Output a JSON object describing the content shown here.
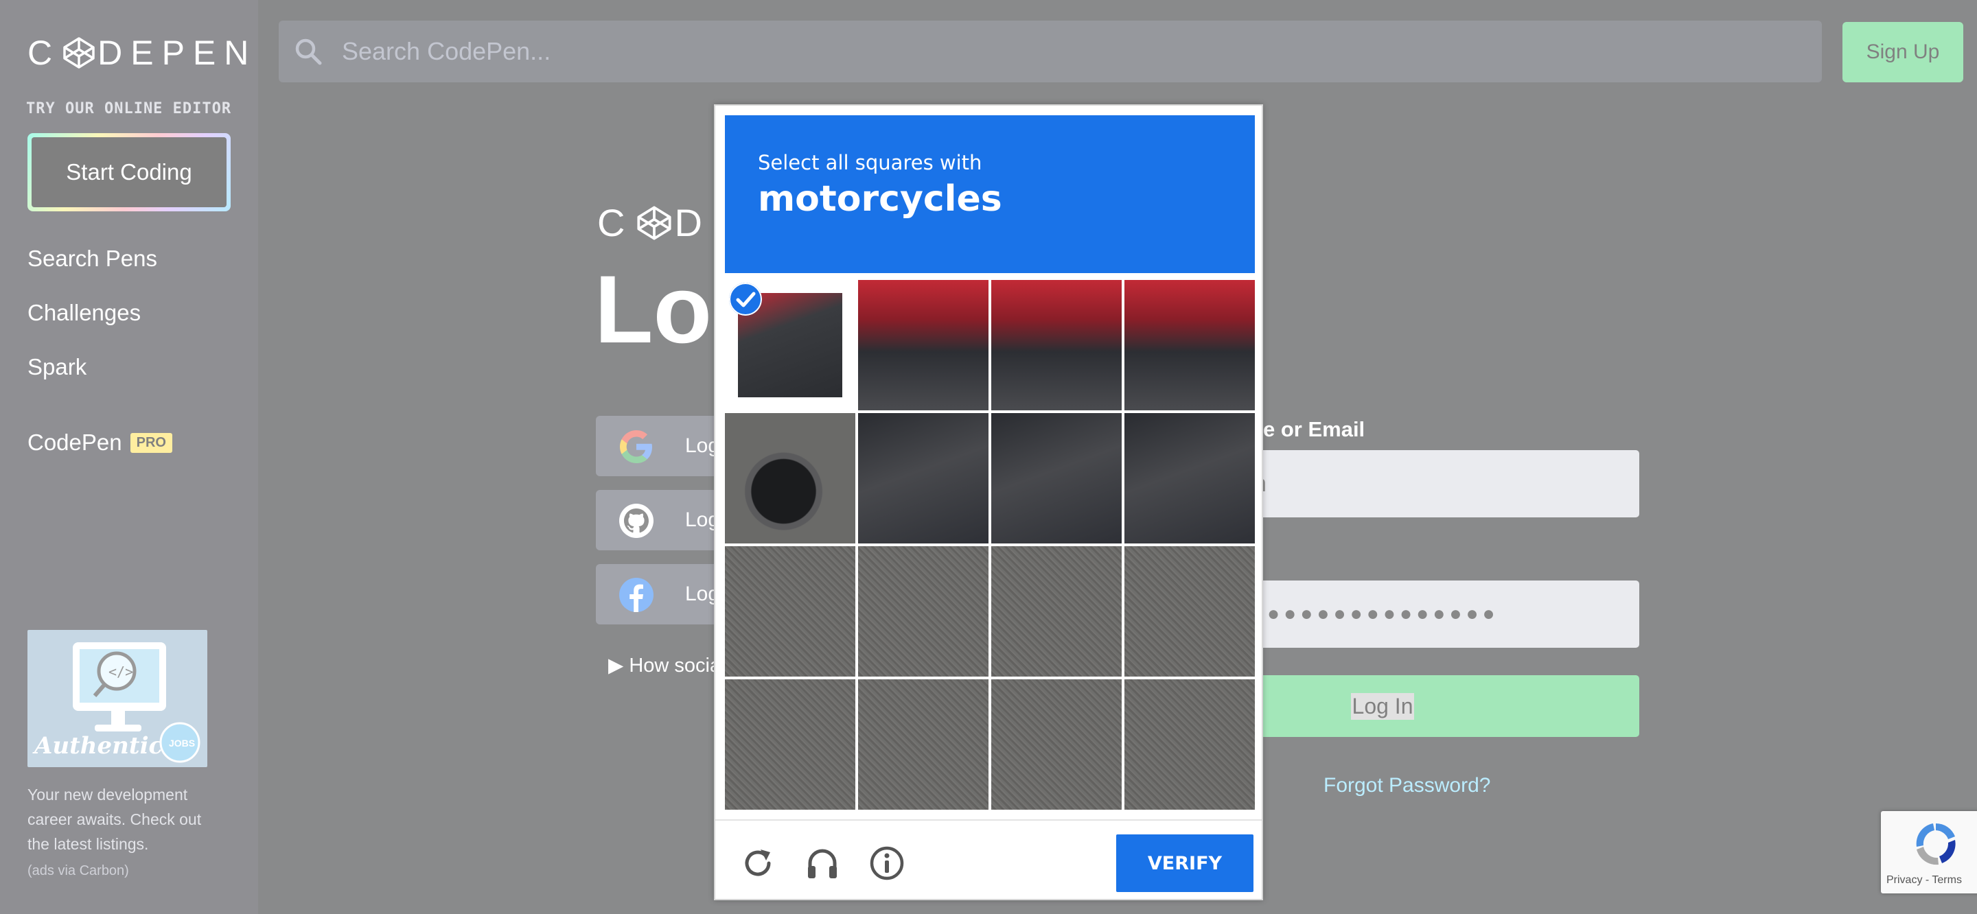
{
  "sidebar": {
    "logo_left": "C",
    "logo_right": "DEPEN",
    "try_label": "TRY OUR ONLINE EDITOR",
    "start_coding": "Start Coding",
    "nav": [
      "Search Pens",
      "Challenges",
      "Spark"
    ],
    "codepen_label": "CodePen",
    "pro_badge": "PRO",
    "ad_image_text": "Authentic",
    "ad_image_badge": "JOBS",
    "ad_text": "Your new development career awaits. Check out the latest listings.",
    "ad_via": "(ads via Carbon)"
  },
  "header": {
    "search_placeholder": "Search CodePen...",
    "signup": "Sign Up"
  },
  "login": {
    "logo_left": "C",
    "logo_right": "D",
    "title": "Log",
    "social": [
      {
        "label": "Log",
        "icon": "google-icon"
      },
      {
        "label": "Log",
        "icon": "github-icon"
      },
      {
        "label": "Log",
        "icon": "facebook-icon"
      }
    ],
    "how_social": "How socia",
    "field_label": "e or Email",
    "username_value": "n",
    "password_value": "●●●●●●●●●●●●●●",
    "login_button": "Log In",
    "forgot": "Forgot Password?"
  },
  "captcha": {
    "instruction": "Select all squares with",
    "target": "motorcycles",
    "verify": "VERIFY",
    "selected_tiles": [
      0
    ],
    "colors": {
      "accent": "#1a73e8"
    }
  },
  "recaptcha_badge": {
    "text": "Privacy - Terms"
  }
}
